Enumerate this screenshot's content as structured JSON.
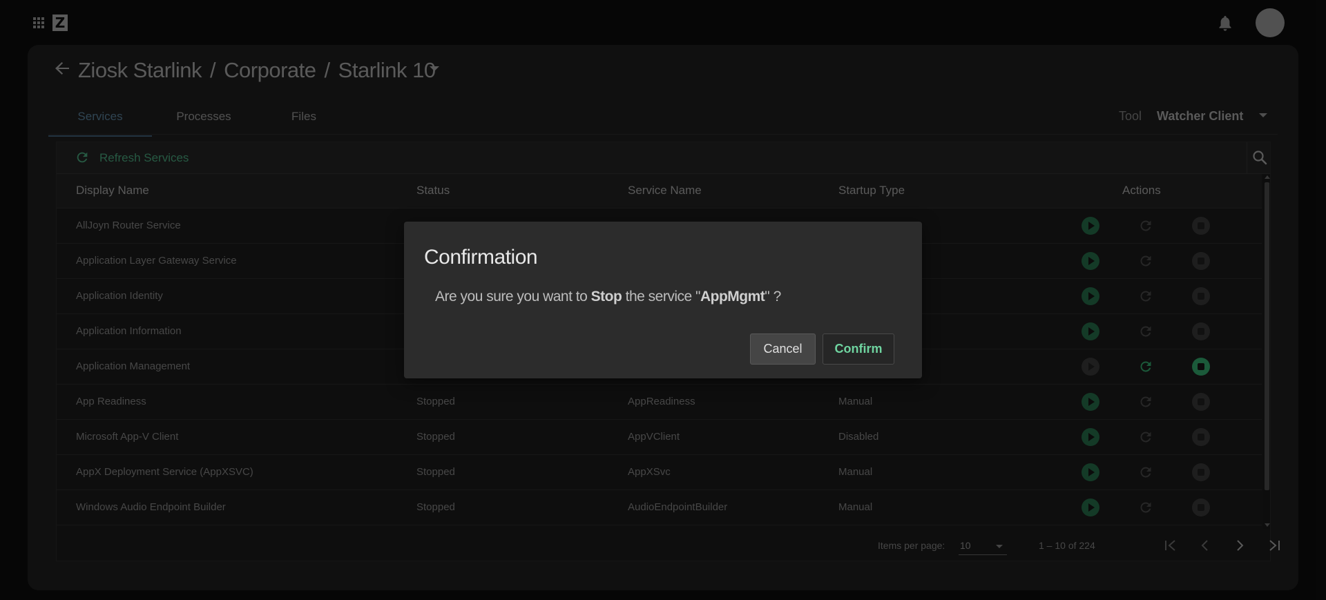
{
  "breadcrumb": {
    "items": [
      "Ziosk Starlink",
      "Corporate",
      "Starlink 10"
    ],
    "separator": "/"
  },
  "tabs": [
    {
      "label": "Services",
      "active": true
    },
    {
      "label": "Processes",
      "active": false
    },
    {
      "label": "Files",
      "active": false
    }
  ],
  "tool": {
    "label": "Tool",
    "value": "Watcher Client"
  },
  "toolbar": {
    "refresh_label": "Refresh Services"
  },
  "table": {
    "columns": [
      "Display Name",
      "Status",
      "Service Name",
      "Startup Type",
      "Actions"
    ],
    "rows": [
      {
        "display_name": "AllJoyn Router Service",
        "status": "",
        "service_name": "",
        "startup_type": "",
        "running": false
      },
      {
        "display_name": "Application Layer Gateway Service",
        "status": "",
        "service_name": "",
        "startup_type": "",
        "running": false
      },
      {
        "display_name": "Application Identity",
        "status": "",
        "service_name": "",
        "startup_type": "",
        "running": false
      },
      {
        "display_name": "Application Information",
        "status": "",
        "service_name": "",
        "startup_type": "",
        "running": false
      },
      {
        "display_name": "Application Management",
        "status": "",
        "service_name": "",
        "startup_type": "",
        "running": true
      },
      {
        "display_name": "App Readiness",
        "status": "Stopped",
        "service_name": "AppReadiness",
        "startup_type": "Manual",
        "running": false
      },
      {
        "display_name": "Microsoft App-V Client",
        "status": "Stopped",
        "service_name": "AppVClient",
        "startup_type": "Disabled",
        "running": false
      },
      {
        "display_name": "AppX Deployment Service (AppXSVC)",
        "status": "Stopped",
        "service_name": "AppXSvc",
        "startup_type": "Manual",
        "running": false
      },
      {
        "display_name": "Windows Audio Endpoint Builder",
        "status": "Stopped",
        "service_name": "AudioEndpointBuilder",
        "startup_type": "Manual",
        "running": false
      }
    ]
  },
  "pagination": {
    "items_per_page_label": "Items per page:",
    "items_per_page": "10",
    "range": "1 – 10 of 224"
  },
  "modal": {
    "title": "Confirmation",
    "msg_prefix": "Are you sure you want to",
    "action": "Stop",
    "msg_middle": "the service \"",
    "service": "AppMgmt",
    "msg_suffix": "\" ?",
    "cancel_label": "Cancel",
    "confirm_label": "Confirm"
  },
  "colors": {
    "accent_green": "#3c8a68",
    "confirm_text": "#6fd4a0",
    "active_tab": "#4a6a80"
  }
}
